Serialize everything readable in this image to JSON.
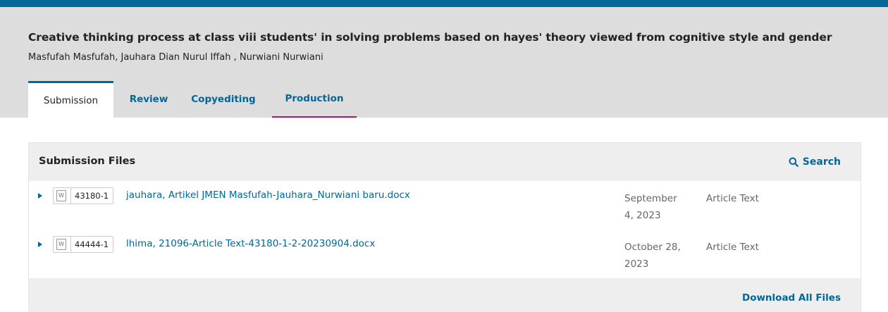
{
  "submission": {
    "title": "Creative thinking process at class viii students' in solving problems based on hayes' theory viewed from cognitive style and gender",
    "authors": "Masfufah Masfufah, Jauhara Dian Nurul Iffah , Nurwiani Nurwiani"
  },
  "tabs": [
    {
      "label": "Submission",
      "active": true
    },
    {
      "label": "Review"
    },
    {
      "label": "Copyediting"
    },
    {
      "label": "Production"
    }
  ],
  "files_panel": {
    "title": "Submission Files",
    "search_label": "Search",
    "files": [
      {
        "id": "43180-1",
        "icon": "doc-icon",
        "icon_glyph": "W",
        "name": "jauhara, Artikel JMEN Masfufah-Jauhara_Nurwiani baru.docx",
        "date_line1": "September",
        "date_line2": "4, 2023",
        "type": "Article Text"
      },
      {
        "id": "44444-1",
        "icon": "doc-icon",
        "icon_glyph": "W",
        "name": "lhima, 21096-Article Text-43180-1-2-20230904.docx",
        "date_line1": "October 28,",
        "date_line2": "2023",
        "type": "Article Text"
      }
    ],
    "download_all_label": "Download All Files"
  },
  "colors": {
    "accent": "#006798",
    "header_bg": "#dddddd",
    "production_underline": "#d00a6c"
  }
}
